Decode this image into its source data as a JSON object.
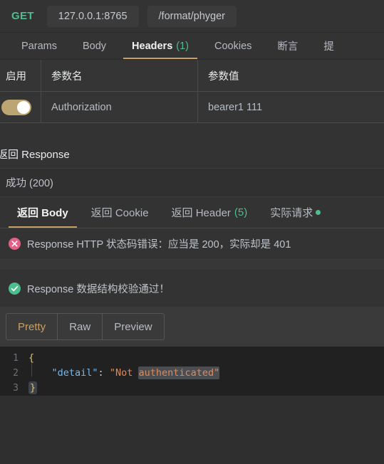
{
  "urlbar": {
    "method": "GET",
    "host": "127.0.0.1:8765",
    "path": "/format/phyger"
  },
  "request_tabs": [
    {
      "label": "Params",
      "count": "",
      "active": false
    },
    {
      "label": "Body",
      "count": "",
      "active": false
    },
    {
      "label": "Headers",
      "count": "(1)",
      "active": true
    },
    {
      "label": "Cookies",
      "count": "",
      "active": false
    },
    {
      "label": "断言",
      "count": "",
      "active": false
    },
    {
      "label": "提",
      "count": "",
      "active": false
    }
  ],
  "param_table": {
    "columns": [
      "启用",
      "参数名",
      "参数值"
    ],
    "rows": [
      {
        "enabled": true,
        "name": "Authorization",
        "value": "bearer1 111"
      }
    ]
  },
  "response": {
    "section_title": "返回 Response",
    "status_text": "成功 (200)",
    "tabs": [
      {
        "label": "返回 Body",
        "count": "",
        "dot": false,
        "active": true
      },
      {
        "label": "返回 Cookie",
        "count": "",
        "dot": false,
        "active": false
      },
      {
        "label": "返回 Header",
        "count": "(5)",
        "dot": false,
        "active": false
      },
      {
        "label": "实际请求",
        "count": "",
        "dot": true,
        "active": false
      }
    ],
    "assertions": [
      {
        "status": "fail",
        "text": "Response HTTP 状态码错误：应当是 200，实际却是 401"
      },
      {
        "status": "pass",
        "text": "Response 数据结构校验通过！"
      }
    ],
    "view_modes": [
      {
        "label": "Pretty",
        "active": true
      },
      {
        "label": "Raw",
        "active": false
      },
      {
        "label": "Preview",
        "active": false
      }
    ],
    "body_code": {
      "lines": [
        {
          "number": "1",
          "open_brace": "{"
        },
        {
          "number": "2",
          "indent": "    ",
          "key": "\"detail\"",
          "colon": ": ",
          "value_plain": "\"Not ",
          "value_hl": "authenticated\""
        },
        {
          "number": "3",
          "close_brace": "}"
        }
      ]
    }
  },
  "colors": {
    "accent": "#c9a063",
    "success": "#4fbd8e",
    "error": "#e06287",
    "background": "#333333",
    "code_background": "#212121"
  }
}
